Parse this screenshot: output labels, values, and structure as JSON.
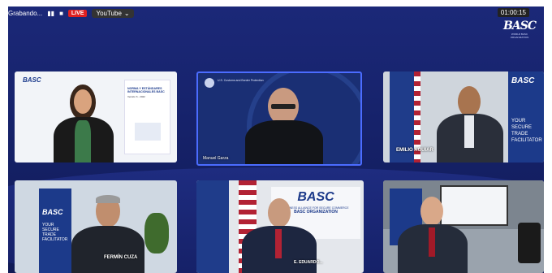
{
  "top_bar": {
    "recording_label": "Grabando...",
    "pause_icon": "pause-icon",
    "stop_icon": "stop-icon",
    "live_badge": "LIVE",
    "platform": "YouTube",
    "timer": "01:00:15"
  },
  "brand": {
    "logo_text": "BASC",
    "logo_subtext": "WORLD BASC ORGANIZATION"
  },
  "participants": [
    {
      "name": "",
      "slide_title": "NORMA Y ESTÁNDARES INTERNACIONALES BASC",
      "slide_version": "Versión 6 - 2022"
    },
    {
      "name": "Manuel Garza",
      "badge": "U.S. Customs and Border Protection"
    },
    {
      "name": "EMILIO AGUIAR",
      "banner_text": "YOUR SECURE TRADE FACILITATOR"
    },
    {
      "name": "FERMÍN CUZA",
      "banner_text": "YOUR SECURE TRADE FACILITATOR"
    },
    {
      "name": "E. EDUARDO...",
      "org_text": "BUSINESS ALLIANCE FOR SECURE COMMERCE",
      "org_name": "BASC ORGANIZATION"
    },
    {
      "name": "",
      "screen_text": ""
    }
  ],
  "colors": {
    "background": "#1b2878",
    "live": "#e02020",
    "active_border": "#4b6cff"
  }
}
